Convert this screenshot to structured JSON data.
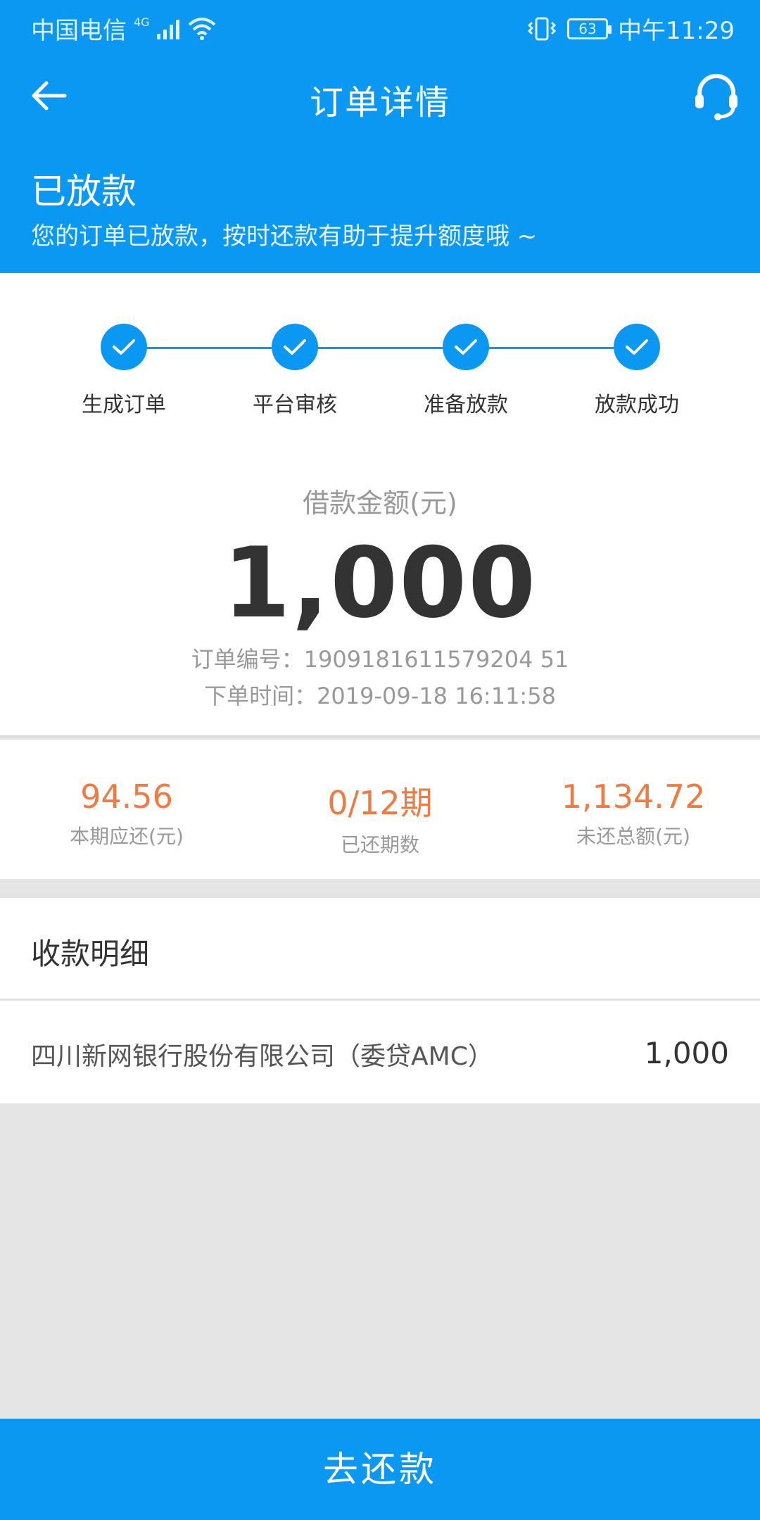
{
  "status_bar": {
    "carrier": "中国电信",
    "network": "4G",
    "battery": "63",
    "time": "中午11:29"
  },
  "nav": {
    "title": "订单详情",
    "back_icon": "arrow-left-icon",
    "service_icon": "headset-icon"
  },
  "header": {
    "status": "已放款",
    "message": "您的订单已放款，按时还款有助于提升额度哦 ~"
  },
  "steps": [
    {
      "label": "生成订单",
      "done": true
    },
    {
      "label": "平台审核",
      "done": true
    },
    {
      "label": "准备放款",
      "done": true
    },
    {
      "label": "放款成功",
      "done": true
    }
  ],
  "loan": {
    "amount_label": "借款金额(元)",
    "amount": "1,000",
    "order_no": "订单编号：1909181611579204 51",
    "order_time": "下单时间：2019-09-18 16:11:58"
  },
  "stats": [
    {
      "value": "94.56",
      "label": "本期应还(元)"
    },
    {
      "value": "0/12期",
      "label": "已还期数"
    },
    {
      "value": "1,134.72",
      "label": "未还总额(元)"
    }
  ],
  "receipt": {
    "title": "收款明细",
    "name": "四川新网银行股份有限公司（委贷AMC）",
    "amount": "1,000"
  },
  "action": {
    "repay_label": "去还款"
  },
  "colors": {
    "primary": "#0a98f2",
    "accent": "#f07b42"
  }
}
